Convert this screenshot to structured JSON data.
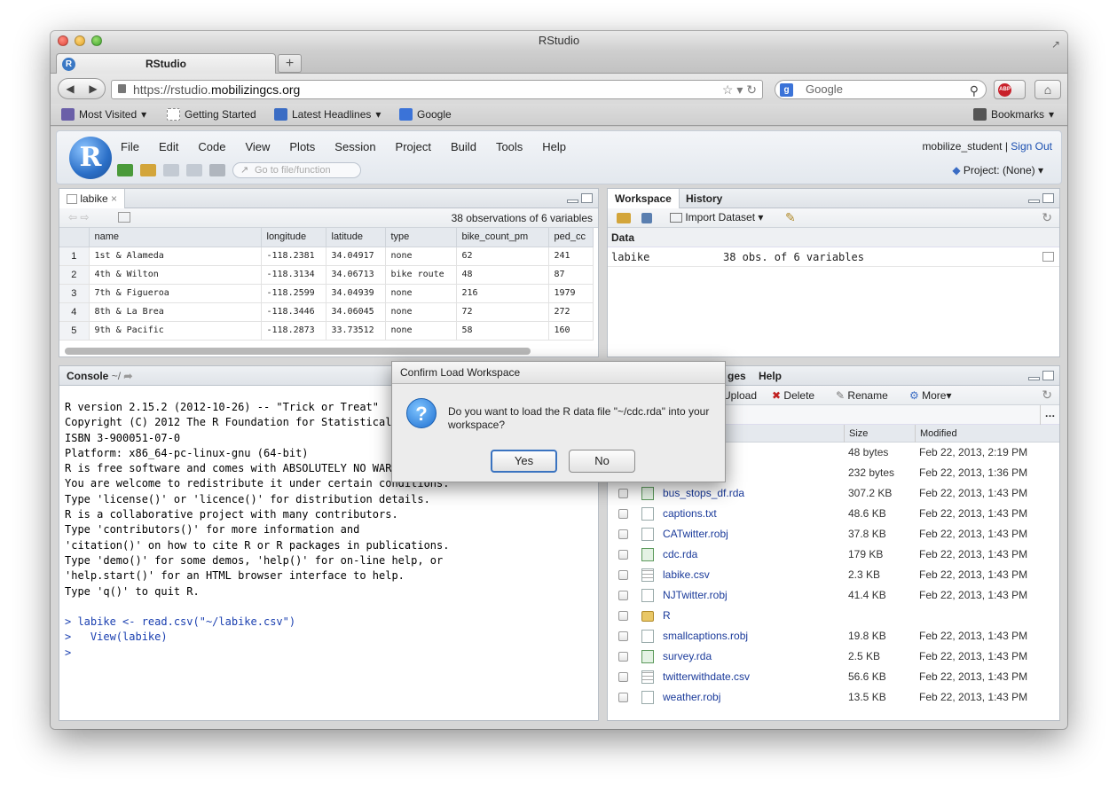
{
  "window": {
    "title": "RStudio"
  },
  "browser": {
    "tab_title": "RStudio",
    "new_tab": "+",
    "url_prefix": "https://rstudio.",
    "url_host": "mobilizingcs.org",
    "search_placeholder": "Google",
    "bookmarks": [
      {
        "label": "Most Visited",
        "icon": "star-folder-icon",
        "dropdown": true
      },
      {
        "label": "Getting Started",
        "icon": "page-icon",
        "dropdown": false
      },
      {
        "label": "Latest Headlines",
        "icon": "rss-icon",
        "dropdown": true
      },
      {
        "label": "Google",
        "icon": "google-icon",
        "dropdown": false
      }
    ],
    "bookmarks_menu": "Bookmarks"
  },
  "rstudio": {
    "menu": [
      "File",
      "Edit",
      "Code",
      "View",
      "Plots",
      "Session",
      "Project",
      "Build",
      "Tools",
      "Help"
    ],
    "user": "mobilize_student",
    "signout": "Sign Out",
    "goto_placeholder": "Go to file/function",
    "project": "Project: (None)"
  },
  "data_viewer": {
    "tab": "labike",
    "summary": "38 observations of 6 variables",
    "columns": [
      "name",
      "longitude",
      "latitude",
      "type",
      "bike_count_pm",
      "ped_cc"
    ],
    "rows": [
      [
        "1",
        "1st & Alameda",
        "-118.2381",
        "34.04917",
        "none",
        "62",
        "241"
      ],
      [
        "2",
        "4th & Wilton",
        "-118.3134",
        "34.06713",
        "bike route",
        "48",
        "87"
      ],
      [
        "3",
        "7th & Figueroa",
        "-118.2599",
        "34.04939",
        "none",
        "216",
        "1979"
      ],
      [
        "4",
        "8th & La Brea",
        "-118.3446",
        "34.06045",
        "none",
        "72",
        "272"
      ],
      [
        "5",
        "9th & Pacific",
        "-118.2873",
        "33.73512",
        "none",
        "58",
        "160"
      ]
    ]
  },
  "workspace": {
    "tabs": [
      "Workspace",
      "History"
    ],
    "import_label": "Import Dataset",
    "section": "Data",
    "items": [
      {
        "name": "labike",
        "value": "38 obs. of 6 variables"
      }
    ]
  },
  "console": {
    "tab": "Console",
    "path": "~/",
    "lines": [
      "R version 2.15.2 (2012-10-26) -- \"Trick or Treat\"",
      "Copyright (C) 2012 The R Foundation for Statistical",
      "ISBN 3-900051-07-0",
      "Platform: x86_64-pc-linux-gnu (64-bit)",
      "",
      "R is free software and comes with ABSOLUTELY NO WARRANTY.",
      "You are welcome to redistribute it under certain conditions.",
      "Type 'license()' or 'licence()' for distribution details.",
      "",
      "R is a collaborative project with many contributors.",
      "Type 'contributors()' for more information and",
      "'citation()' on how to cite R or R packages in publications.",
      "",
      "Type 'demo()' for some demos, 'help()' for on-line help, or",
      "'help.start()' for an HTML browser interface to help.",
      "Type 'q()' to quit R."
    ],
    "commands": [
      "> labike <- read.csv(\"~/labike.csv\")",
      ">   View(labike)",
      "> "
    ]
  },
  "files": {
    "tabs": [
      "ges",
      "Help"
    ],
    "actions": {
      "upload": "Upload",
      "delete": "Delete",
      "rename": "Rename",
      "more": "More"
    },
    "columns": {
      "size": "Size",
      "modified": "Modified"
    },
    "rows": [
      {
        "name": "",
        "size": "48 bytes",
        "modified": "Feb 22, 2013, 2:19 PM",
        "icon": "file"
      },
      {
        "name": "",
        "size": "232 bytes",
        "modified": "Feb 22, 2013, 1:36 PM",
        "icon": "file"
      },
      {
        "name": "bus_stops_df.rda",
        "size": "307.2 KB",
        "modified": "Feb 22, 2013, 1:43 PM",
        "icon": "rda"
      },
      {
        "name": "captions.txt",
        "size": "48.6 KB",
        "modified": "Feb 22, 2013, 1:43 PM",
        "icon": "file"
      },
      {
        "name": "CATwitter.robj",
        "size": "37.8 KB",
        "modified": "Feb 22, 2013, 1:43 PM",
        "icon": "file"
      },
      {
        "name": "cdc.rda",
        "size": "179 KB",
        "modified": "Feb 22, 2013, 1:43 PM",
        "icon": "rda"
      },
      {
        "name": "labike.csv",
        "size": "2.3 KB",
        "modified": "Feb 22, 2013, 1:43 PM",
        "icon": "grid"
      },
      {
        "name": "NJTwitter.robj",
        "size": "41.4 KB",
        "modified": "Feb 22, 2013, 1:43 PM",
        "icon": "file"
      },
      {
        "name": "R",
        "size": "",
        "modified": "",
        "icon": "folder"
      },
      {
        "name": "smallcaptions.robj",
        "size": "19.8 KB",
        "modified": "Feb 22, 2013, 1:43 PM",
        "icon": "file"
      },
      {
        "name": "survey.rda",
        "size": "2.5 KB",
        "modified": "Feb 22, 2013, 1:43 PM",
        "icon": "rda"
      },
      {
        "name": "twitterwithdate.csv",
        "size": "56.6 KB",
        "modified": "Feb 22, 2013, 1:43 PM",
        "icon": "grid"
      },
      {
        "name": "weather.robj",
        "size": "13.5 KB",
        "modified": "Feb 22, 2013, 1:43 PM",
        "icon": "file"
      }
    ]
  },
  "dialog": {
    "title": "Confirm Load Workspace",
    "message": "Do you want to load the R data file \"~/cdc.rda\" into your workspace?",
    "yes": "Yes",
    "no": "No"
  }
}
